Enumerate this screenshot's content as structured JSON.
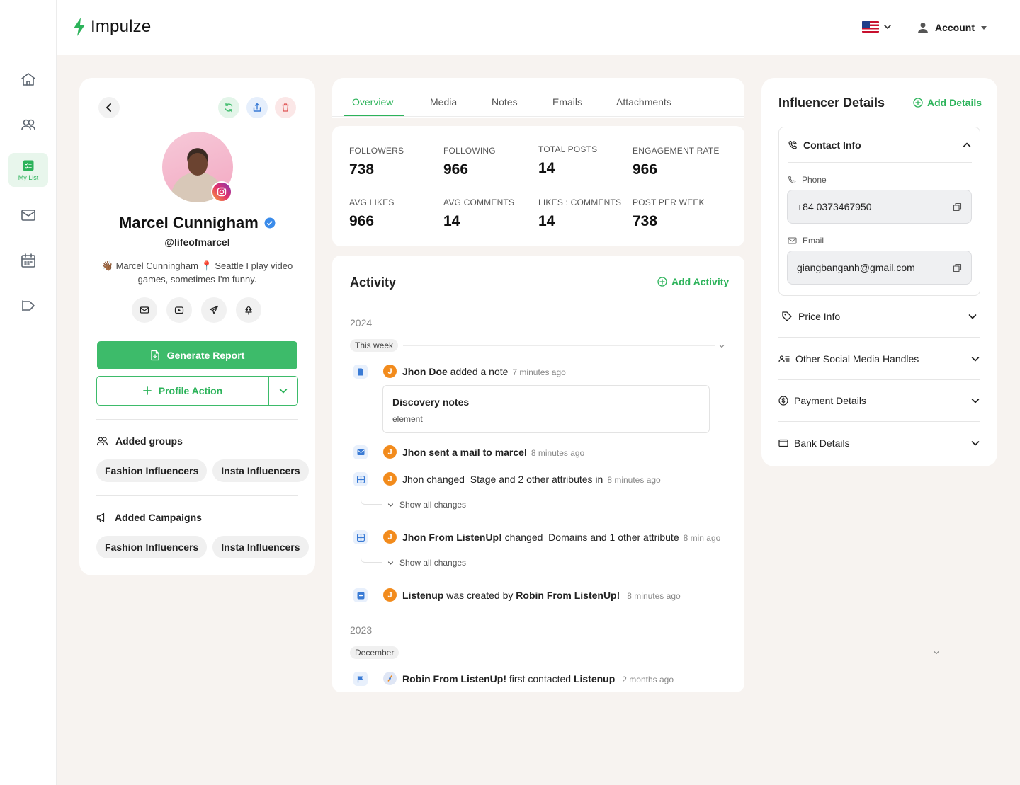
{
  "app": {
    "name": "Impulze"
  },
  "header": {
    "account_label": "Account",
    "flag_icon": "us-flag-icon"
  },
  "sidebar": {
    "items": [
      {
        "icon": "home-icon",
        "label": ""
      },
      {
        "icon": "users-icon",
        "label": ""
      },
      {
        "icon": "checklist-icon",
        "label": "My List",
        "active": true
      },
      {
        "icon": "mail-icon",
        "label": ""
      },
      {
        "icon": "calendar-icon",
        "label": ""
      },
      {
        "icon": "megaphone-icon",
        "label": ""
      }
    ]
  },
  "profile": {
    "name": "Marcel Cunnigham",
    "handle": "@lifeofmarcel",
    "bio": "👋🏾 Marcel Cunningham 📍 Seattle I play video games, sometimes I'm funny.",
    "generate_report_label": "Generate Report",
    "profile_action_label": "Profile Action",
    "groups_title": "Added groups",
    "groups": [
      "Fashion Influencers",
      "Insta Influencers"
    ],
    "campaigns_title": "Added Campaigns",
    "campaigns": [
      "Fashion Influencers",
      "Insta Influencers"
    ]
  },
  "tabs": [
    "Overview",
    "Media",
    "Notes",
    "Emails",
    "Attachments"
  ],
  "stats": [
    {
      "label": "FOLLOWERS",
      "value": "738"
    },
    {
      "label": "FOLLOWING",
      "value": "966"
    },
    {
      "label": "TOTAL POSTS",
      "value": "14"
    },
    {
      "label": "ENGAGEMENT RATE",
      "value": "966"
    },
    {
      "label": "AVG LIKES",
      "value": "966"
    },
    {
      "label": "AVG COMMENTS",
      "value": "14"
    },
    {
      "label": "LIKES : COMMENTS",
      "value": "14"
    },
    {
      "label": "POST PER WEEK",
      "value": "738"
    }
  ],
  "activity": {
    "title": "Activity",
    "add_label": "Add Activity",
    "year_2024": "2024",
    "period_this_week": "This week",
    "year_2023": "2023",
    "period_december": "December",
    "show_all_changes": "Show all changes",
    "events": [
      {
        "avatar": "J",
        "actor": "Jhon Doe",
        "text": " added a note",
        "time": "7 minutes ago"
      },
      {
        "avatar": "J",
        "actor": "Jhon sent a mail to marcel",
        "text": "",
        "time": "8 minutes ago"
      },
      {
        "avatar": "J",
        "actor": "Jhon",
        "text": " changed  ",
        "target": "Stage and 2 other attributes in",
        "time": "8 minutes ago"
      },
      {
        "avatar": "J",
        "actor": "Jhon From ListenUp!",
        "text": " changed  ",
        "target": "Domains and 1 other attribute",
        "time": "8 min ago"
      },
      {
        "avatar": "J",
        "actor": "Listenup",
        "text": " was created by ",
        "target": "Robin From ListenUp!",
        "time": "8 minutes ago"
      },
      {
        "avatar": "",
        "actor": "Robin From ListenUp!",
        "text": " first contacted ",
        "target": "Listenup",
        "time": "2 months ago"
      }
    ],
    "note": {
      "title": "Discovery notes",
      "subtitle": "element"
    }
  },
  "details": {
    "title": "Influencer Details",
    "add_label": "Add Details",
    "contact_title": "Contact Info",
    "phone_label": "Phone",
    "phone_value": "+84 0373467950",
    "email_label": "Email",
    "email_value": "giangbanganh@gmail.com",
    "sections": [
      "Price Info",
      "Other Social Media Handles",
      "Payment Details",
      "Bank Details"
    ]
  },
  "colors": {
    "accent": "#3dbb6a",
    "avatar_orange": "#f28b1c"
  }
}
